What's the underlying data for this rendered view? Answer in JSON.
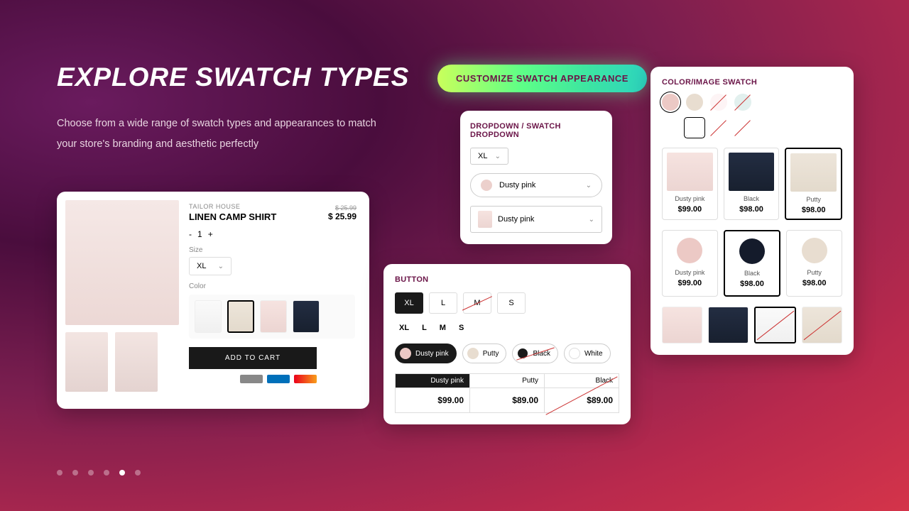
{
  "hero": {
    "title": "EXPLORE SWATCH TYPES",
    "subtitle": "Choose from a wide range of swatch types and appearances to match your store's branding and aesthetic perfectly",
    "cta": "CUSTOMIZE SWATCH APPEARANCE"
  },
  "product": {
    "brand": "TAILOR HOUSE",
    "name": "LINEN CAMP SHIRT",
    "price_orig": "$ 25.99",
    "price_sale": "$ 25.99",
    "qty_minus": "-",
    "qty_val": "1",
    "qty_plus": "+",
    "size_label": "Size",
    "size_value": "XL",
    "color_label": "Color",
    "add_to_cart": "ADD TO CART"
  },
  "dropdown": {
    "title": "DROPDOWN / SWATCH DROPDOWN",
    "size": "XL",
    "color_pill": "Dusty pink",
    "color_rect": "Dusty pink"
  },
  "button": {
    "title": "BUTTON",
    "sizes": [
      "XL",
      "L",
      "M",
      "S"
    ],
    "sizes2": [
      "XL",
      "L",
      "M",
      "S"
    ],
    "pills": [
      {
        "name": "Dusty pink"
      },
      {
        "name": "Putty"
      },
      {
        "name": "Black"
      },
      {
        "name": "White"
      }
    ],
    "pricecells": [
      {
        "name": "Dusty pink",
        "price": "$99.00"
      },
      {
        "name": "Putty",
        "price": "$89.00"
      },
      {
        "name": "Black",
        "price": "$89.00"
      }
    ]
  },
  "colorimage": {
    "title": "COLOR/IMAGE SWATCH",
    "products1": [
      {
        "name": "Dusty pink",
        "price": "$99.00"
      },
      {
        "name": "Black",
        "price": "$98.00"
      },
      {
        "name": "Putty",
        "price": "$98.00"
      }
    ],
    "products2": [
      {
        "name": "Dusty pink",
        "price": "$99.00"
      },
      {
        "name": "Black",
        "price": "$98.00"
      },
      {
        "name": "Putty",
        "price": "$98.00"
      }
    ]
  },
  "pager": {
    "total": 6,
    "active": 4
  }
}
